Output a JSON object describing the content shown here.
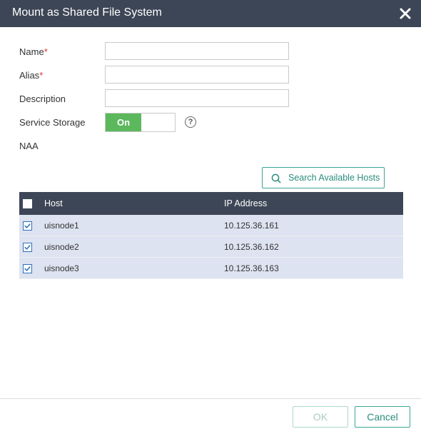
{
  "dialog": {
    "title": "Mount as Shared File System"
  },
  "form": {
    "name_label": "Name",
    "alias_label": "Alias",
    "required_mark": "*",
    "description_label": "Description",
    "service_storage_label": "Service Storage",
    "service_storage_toggle": "On",
    "naa_label": "NAA",
    "name_value": "",
    "alias_value": "",
    "description_value": ""
  },
  "search_button_label": "Search Available Hosts",
  "table": {
    "columns": [
      "Host",
      "IP Address"
    ],
    "rows": [
      {
        "host": "uisnode1",
        "ip": "10.125.36.161",
        "checked": true
      },
      {
        "host": "uisnode2",
        "ip": "10.125.36.162",
        "checked": true
      },
      {
        "host": "uisnode3",
        "ip": "10.125.36.163",
        "checked": true
      }
    ]
  },
  "footer": {
    "ok_label": "OK",
    "cancel_label": "Cancel"
  },
  "colors": {
    "header_bg": "#3d4656",
    "toggle_on": "#5cb85c",
    "accent": "#3aa594",
    "row_bg": "#dde3f0"
  },
  "icons": {
    "close": "close-icon",
    "help": "help-icon",
    "search": "search-icon",
    "checkbox": "checkbox-checked-icon"
  }
}
